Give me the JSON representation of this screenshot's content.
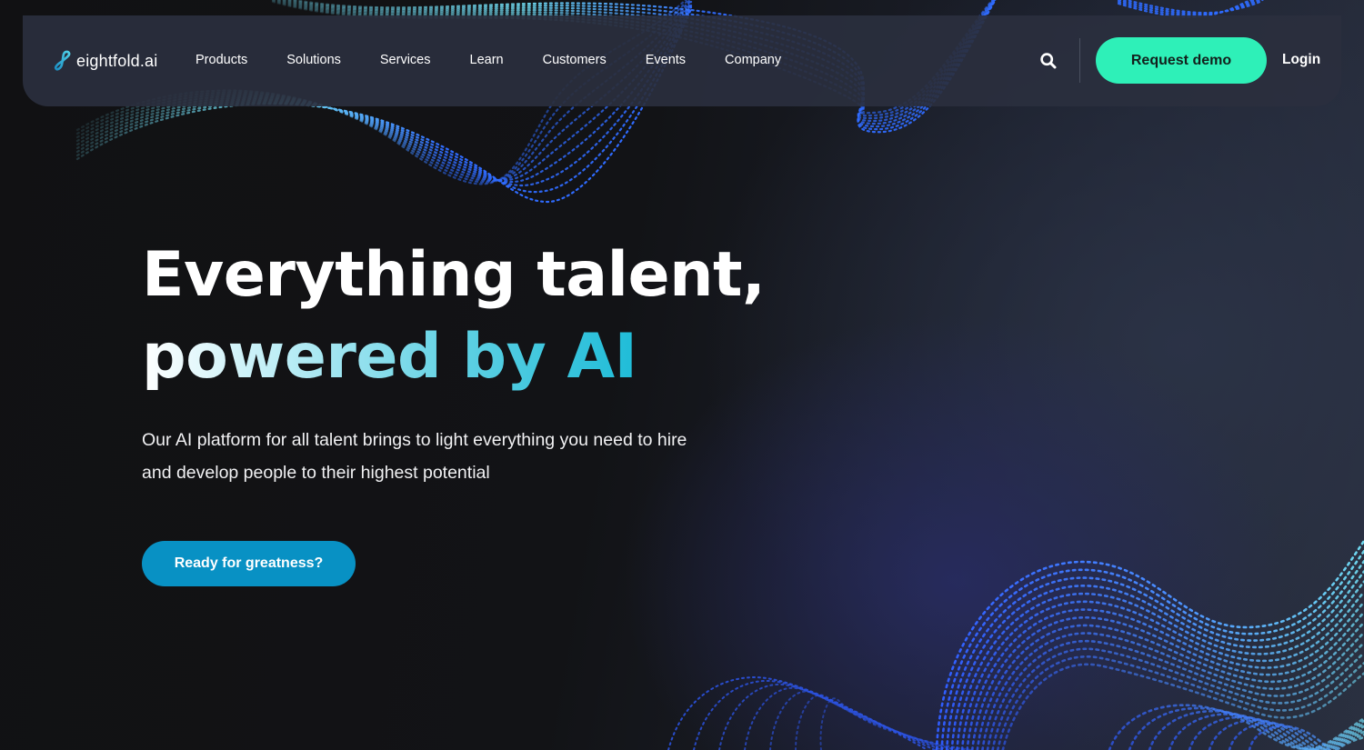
{
  "brand": {
    "logo_icon": "infinity-link-icon",
    "name": "eightfold.ai"
  },
  "nav": {
    "items": [
      {
        "label": "Products"
      },
      {
        "label": "Solutions"
      },
      {
        "label": "Services"
      },
      {
        "label": "Learn"
      },
      {
        "label": "Customers"
      },
      {
        "label": "Events"
      },
      {
        "label": "Company"
      }
    ],
    "search_icon": "search-icon",
    "request_demo_label": "Request demo",
    "login_label": "Login"
  },
  "hero": {
    "title_line1": "Everything talent,",
    "title_line2": "powered by AI",
    "subtitle": "Our AI platform for all talent brings to light everything you need to hire and develop people to their highest potential",
    "cta_label": "Ready for greatness?"
  },
  "colors": {
    "background": "#111113",
    "navbar": "#2a2f3e",
    "accent_green": "#2ef0b8",
    "accent_blue": "#0891c4",
    "gradient_cyan": "#1fbcd8",
    "wave_blue": "#2f6bff",
    "wave_cyan": "#6fd8ee"
  }
}
